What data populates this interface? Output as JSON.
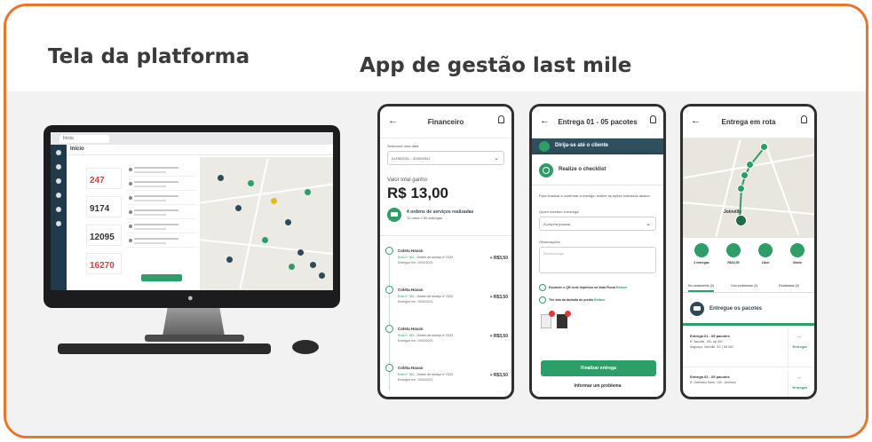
{
  "colors": {
    "border": "#ec7428",
    "brand_green": "#2e9e68",
    "dark_navy": "#2f4f5f",
    "alert_red": "#d64040"
  },
  "headings": {
    "platform": "Tela da platforma",
    "app": "App de gestão last mile"
  },
  "desktop": {
    "tab_label": "Início",
    "page_title": "Início",
    "stats": [
      "247",
      "9174",
      "12095",
      "16270"
    ],
    "icons": [
      "menu-icon",
      "truck-icon",
      "box-icon",
      "map-icon",
      "users-icon",
      "settings-icon"
    ]
  },
  "app_financeiro": {
    "title": "Financeiro",
    "period_label": "Selecione uma data",
    "period_value": "01/05/2021 - 31/05/2021",
    "total_label": "Valor total ganho",
    "total_value": "R$ 13,00",
    "orders_bold": "4 ordens de serviços realizadas",
    "orders_sub": "12 rotas // 50 entregas",
    "payments": [
      {
        "who": "Coleta Havan",
        "route": "Rota nº 363",
        "desc": " - Ordem de serviço nº 2323",
        "date": "Entregue em: 19/04/2021",
        "amount": "+ R$3,50"
      },
      {
        "who": "Coleta Havan",
        "route": "Rota nº 363",
        "desc": " - Ordem de serviço nº 2323",
        "date": "Entregue em: 19/04/2021",
        "amount": "+ R$3,50"
      },
      {
        "who": "Coleta Havan",
        "route": "Rota nº 363",
        "desc": " - Ordem de serviço nº 2323",
        "date": "Entregue em: 19/04/2021",
        "amount": "+ R$3,50"
      },
      {
        "who": "Coleta Havan",
        "route": "Rota nº 363",
        "desc": " - Ordem de serviço nº 2323",
        "date": "Entregue em: 19/04/2021",
        "amount": "+ R$3,50"
      }
    ]
  },
  "app_checklist": {
    "title": "Entrega 01 - 05 pacotes",
    "banner": "Dirija-se até o cliente",
    "sheet_title": "Realize o checklist",
    "instructions": "Para finalizar e confirmar a entrega, realize as ações indicadas abaixo:",
    "receiver_label": "Quem recebeu a entrega",
    "receiver_value": "A própria pessoa",
    "notes_label": "Observações",
    "notes_placeholder": "Escreva aqui",
    "check_qr": "Escaneie o QR code impresso na Nota Fiscal",
    "check_photo": "Tire foto da fachada do prédio",
    "redo": "Refazer",
    "finish_button": "Finalizar entrega",
    "problem_link": "Informar um problema"
  },
  "app_route": {
    "title": "Entrega em rota",
    "city": "Joinville",
    "metrics": [
      "3 entregas",
      "R$34,00",
      "11km",
      "3hmin"
    ],
    "tabs": [
      "Em andamento (3)",
      "Com problemas (0)",
      "Finalizadas (5)"
    ],
    "section_title": "Entregue os pacotes",
    "deliveries": [
      {
        "title": "Entrega 01 - 05 pacotes",
        "addr1": "R. Itacolisi, 134, ap 402 -",
        "addr2": "Saguaçu, Joinville, SC | 58.340",
        "action": "Entregar"
      },
      {
        "title": "Entrega 02 - 05 pacotes",
        "addr1": "R. Germano Stein, 149 - América",
        "addr2": "",
        "action": "Entregar"
      }
    ]
  }
}
